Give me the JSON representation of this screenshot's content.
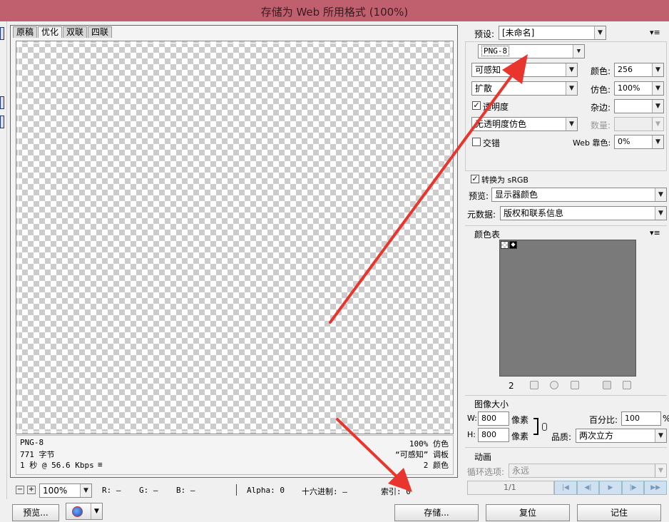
{
  "window": {
    "title": "存储为 Web 所用格式 (100%)"
  },
  "tabs": [
    "原稿",
    "优化",
    "双联",
    "四联"
  ],
  "info": {
    "format": "PNG-8",
    "size": "771 字节",
    "speed": "1 秒 @ 56.6 Kbps",
    "menu_icon": "≡",
    "dither_pct": "100% 仿色",
    "palette": "“可感知” 调板",
    "colors": "2 颜色"
  },
  "status": {
    "zoom": "100%",
    "r": "R: —",
    "g": "G: —",
    "b": "B: —",
    "alpha": "Alpha: 0",
    "hex": "十六进制: —",
    "index": "索引: 0"
  },
  "settings": {
    "preset_label": "预设:",
    "preset_value": "[未命名]",
    "format_value": "PNG-8",
    "reduction_value": "可感知",
    "colors_label": "颜色:",
    "colors_value": "256",
    "dither_algo": "扩散",
    "dither_label": "仿色:",
    "dither_value": "100%",
    "transparency_label": "透明度",
    "matte_label": "杂边:",
    "transparency_dither": "无透明度仿色",
    "amount_label": "数量:",
    "interlaced_label": "交错",
    "web_snap_label": "Web 靠色:",
    "web_snap_value": "0%",
    "convert_srgb_label": "转换为 sRGB",
    "preview_label": "预览:",
    "preview_value": "显示器颜色",
    "metadata_label": "元数据:",
    "metadata_value": "版权和联系信息"
  },
  "color_table": {
    "title": "颜色表",
    "count": "2"
  },
  "image_size": {
    "title": "图像大小",
    "w_label": "W:",
    "w_value": "800",
    "h_label": "H:",
    "h_value": "800",
    "unit": "像素",
    "percent_label": "百分比:",
    "percent_value": "100",
    "percent_unit": "%",
    "quality_label": "品质:",
    "quality_value": "两次立方"
  },
  "animation": {
    "title": "动画",
    "loop_label": "循环选项:",
    "loop_value": "永远",
    "frame": "1/1"
  },
  "buttons": {
    "preview": "预览...",
    "save": "存储...",
    "reset": "复位",
    "remember": "记住"
  },
  "colors": {
    "titlebar": "#c0606f",
    "arrow": "#e8352e"
  }
}
